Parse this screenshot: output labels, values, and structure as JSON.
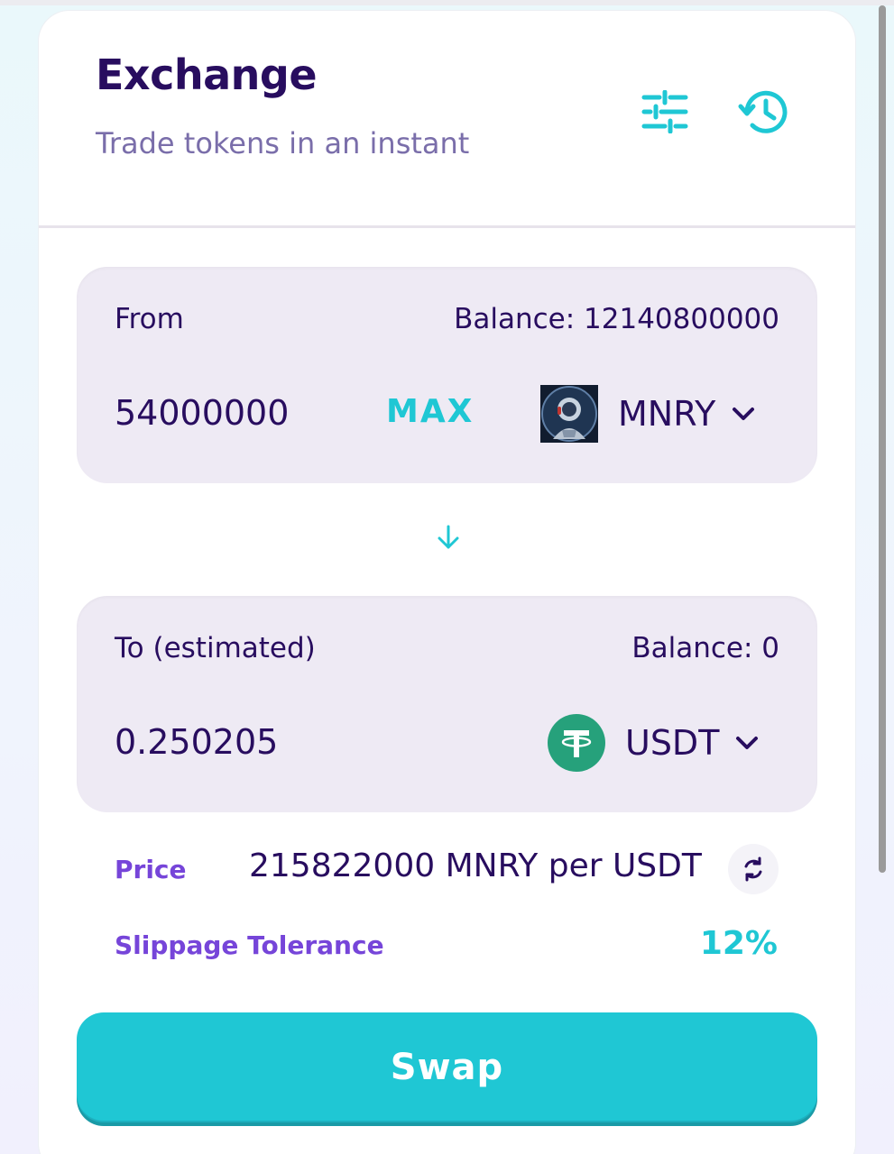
{
  "header": {
    "title": "Exchange",
    "subtitle": "Trade tokens in an instant",
    "settings_icon": "settings-sliders-icon",
    "history_icon": "history-clock-icon"
  },
  "from": {
    "label": "From",
    "balance": "Balance: 12140800000",
    "amount": "54000000",
    "max_label": "MAX",
    "token_symbol": "MNRY",
    "token_logo": "mnry-astronaut-logo"
  },
  "to": {
    "label": "To (estimated)",
    "balance": "Balance: 0",
    "amount": "0.250205",
    "token_symbol": "USDT",
    "token_logo": "tether-logo"
  },
  "price": {
    "label": "Price",
    "value": "215822000 MNRY per USDT"
  },
  "slippage": {
    "label": "Slippage Tolerance",
    "value": "12%"
  },
  "swap_label": "Swap",
  "colors": {
    "primary": "#1fc7d4",
    "text": "#280d5f",
    "secondary": "#7645d9",
    "subtle": "#7a6eaa",
    "panel": "#eeeaf4",
    "usdt": "#26a17b"
  }
}
